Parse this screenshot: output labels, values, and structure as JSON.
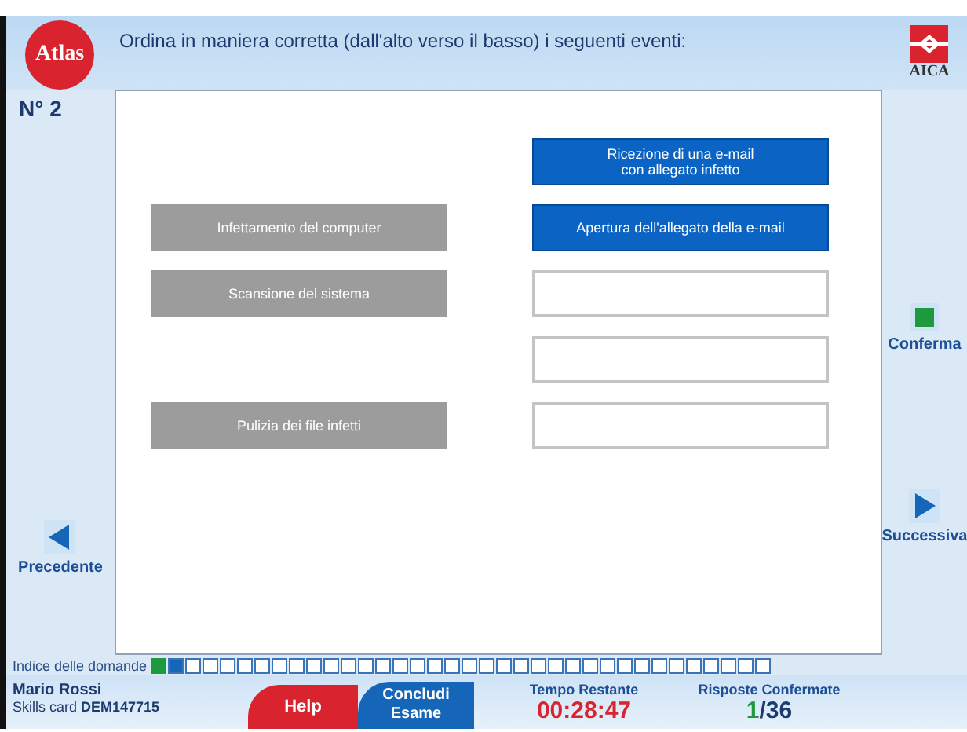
{
  "header": {
    "logo": "Atlas",
    "question": "Ordina in maniera corretta (dall'alto verso il basso) i seguenti eventi:",
    "brand": "AICA"
  },
  "question_number": "N° 2",
  "rows": [
    {
      "slot": {
        "kind": "filled",
        "label": "Ricezione di una e-mail\ncon allegato infetto"
      }
    },
    {
      "event": "Infettamento del computer",
      "slot": {
        "kind": "filled",
        "label": "Apertura dell'allegato della e-mail"
      }
    },
    {
      "event": "Scansione del sistema",
      "slot": {
        "kind": "empty"
      }
    },
    {
      "slot": {
        "kind": "empty"
      }
    },
    {
      "event": "Pulizia dei file infetti",
      "slot": {
        "kind": "empty"
      }
    }
  ],
  "nav": {
    "previous": "Precedente",
    "confirm": "Conferma",
    "next": "Successiva"
  },
  "index": {
    "label": "Indice delle domande",
    "items": [
      {
        "answered": true,
        "selected": false
      },
      {
        "answered": false,
        "selected": true
      },
      {
        "answered": false,
        "selected": false
      },
      {
        "answered": false,
        "selected": false
      },
      {
        "answered": false,
        "selected": false
      },
      {
        "answered": false,
        "selected": false
      },
      {
        "answered": false,
        "selected": false
      },
      {
        "answered": false,
        "selected": false
      },
      {
        "answered": false,
        "selected": false
      },
      {
        "answered": false,
        "selected": false
      },
      {
        "answered": false,
        "selected": false
      },
      {
        "answered": false,
        "selected": false
      },
      {
        "answered": false,
        "selected": false
      },
      {
        "answered": false,
        "selected": false
      },
      {
        "answered": false,
        "selected": false
      },
      {
        "answered": false,
        "selected": false
      },
      {
        "answered": false,
        "selected": false
      },
      {
        "answered": false,
        "selected": false
      },
      {
        "answered": false,
        "selected": false
      },
      {
        "answered": false,
        "selected": false
      },
      {
        "answered": false,
        "selected": false
      },
      {
        "answered": false,
        "selected": false
      },
      {
        "answered": false,
        "selected": false
      },
      {
        "answered": false,
        "selected": false
      },
      {
        "answered": false,
        "selected": false
      },
      {
        "answered": false,
        "selected": false
      },
      {
        "answered": false,
        "selected": false
      },
      {
        "answered": false,
        "selected": false
      },
      {
        "answered": false,
        "selected": false
      },
      {
        "answered": false,
        "selected": false
      },
      {
        "answered": false,
        "selected": false
      },
      {
        "answered": false,
        "selected": false
      },
      {
        "answered": false,
        "selected": false
      },
      {
        "answered": false,
        "selected": false
      },
      {
        "answered": false,
        "selected": false
      },
      {
        "answered": false,
        "selected": false
      }
    ]
  },
  "footer": {
    "user": "Mario Rossi",
    "card": "Skills card **DEM147715**",
    "help": "Help",
    "finish": "Concludi\nEsame",
    "time_label": "Tempo Restante",
    "time": "00:28:47",
    "confirmed_label": "Risposte Confermate",
    "confirmed": "1",
    "total": "/36"
  }
}
